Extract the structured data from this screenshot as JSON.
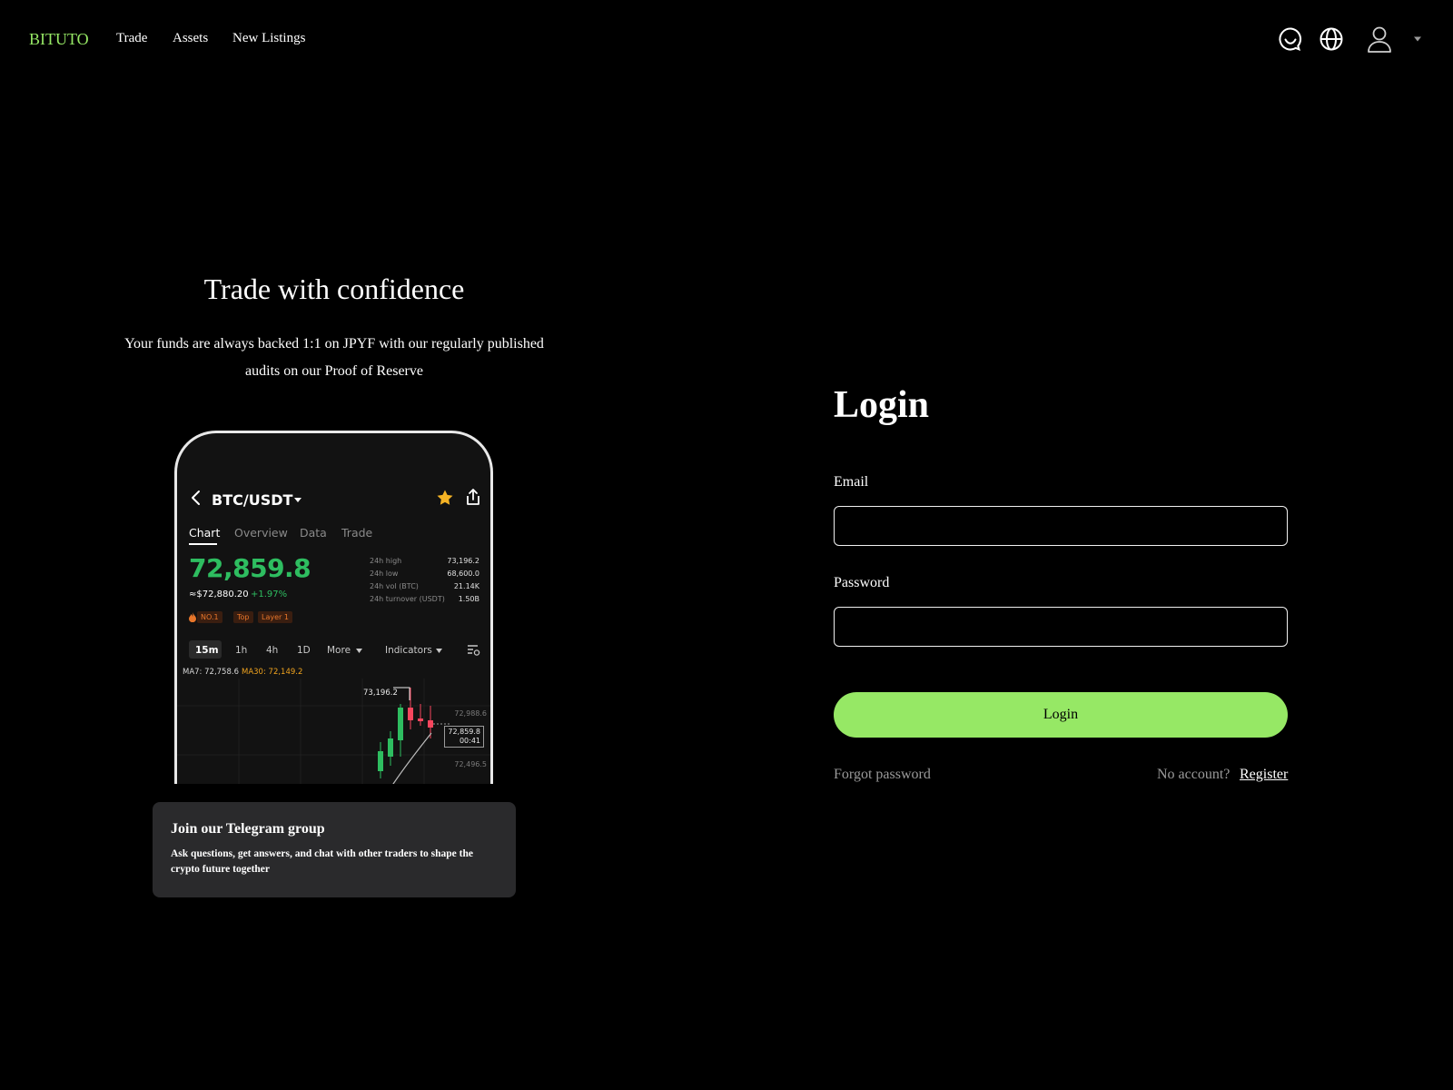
{
  "brand": {
    "name": "BITUTO",
    "accent": "#96e865"
  },
  "nav": {
    "items": [
      "Trade",
      "Assets",
      "New Listings"
    ]
  },
  "header_icons": [
    "support-chat-icon",
    "globe-icon",
    "user-icon",
    "caret-down-icon"
  ],
  "hero": {
    "title": "Trade with confidence",
    "subtitle": "Your funds are always backed 1:1 on JPYF with our regularly published audits on our Proof of Reserve"
  },
  "phone": {
    "pair": "BTC/USDT",
    "tabs": [
      "Chart",
      "Overview",
      "Data",
      "Trade"
    ],
    "price": "72,859.8",
    "fiat": "≈$72,880.20",
    "change": "+1.97%",
    "stats": [
      {
        "label": "24h high",
        "value": "73,196.2"
      },
      {
        "label": "24h low",
        "value": "68,600.0"
      },
      {
        "label": "24h vol (BTC)",
        "value": "21.14K"
      },
      {
        "label": "24h turnover (USDT)",
        "value": "1.50B"
      }
    ],
    "tags": [
      "NO.1",
      "Top",
      "Layer 1"
    ],
    "timeframes": [
      "15m",
      "1h",
      "4h",
      "1D",
      "More",
      "Indicators"
    ],
    "ma7": "MA7: 72,758.6",
    "ma30": "MA30: 72,149.2",
    "chart_high": "73,196.2",
    "axis": [
      "72,988.6",
      "72,496.5"
    ],
    "current_price": "72,859.8",
    "countdown": "00:41",
    "colors": {
      "up": "#2ebd60",
      "down": "#f6465d",
      "ma30": "#f0a31e",
      "star": "#f5b324"
    }
  },
  "telegram": {
    "title": "Join our Telegram group",
    "text": "Ask questions, get answers, and chat with other traders to shape the crypto future together"
  },
  "login": {
    "title": "Login",
    "email_label": "Email",
    "email_value": "",
    "password_label": "Password",
    "password_value": "",
    "button": "Login",
    "forgot": "Forgot password",
    "no_account": "No account?",
    "register": "Register"
  }
}
